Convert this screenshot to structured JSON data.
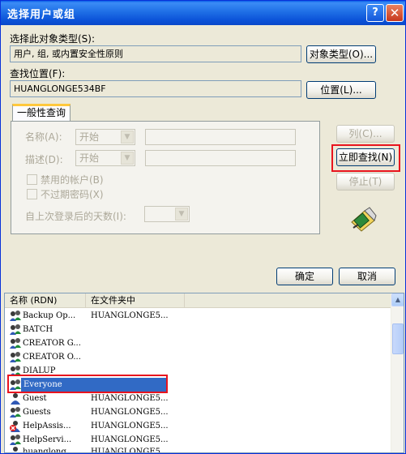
{
  "window": {
    "title": "选择用户或组",
    "help_glyph": "?",
    "close_glyph": "✕"
  },
  "object_type": {
    "label": "选择此对象类型(S):",
    "value": "用户, 组, 或内置安全性原则",
    "button": "对象类型(O)..."
  },
  "location": {
    "label": "查找位置(F):",
    "value": "HUANGLONGE534BF",
    "button": "位置(L)..."
  },
  "tab": {
    "label": "一般性查询"
  },
  "query": {
    "name_label": "名称(A):",
    "name_combo": "开始",
    "desc_label": "描述(D):",
    "desc_combo": "开始",
    "disabled_accounts": "禁用的帐户(B)",
    "non_expiring_pwd": "不过期密码(X)",
    "days_label": "自上次登录后的天数(I):"
  },
  "side_buttons": {
    "columns": "列(C)...",
    "find_now": "立即查找(N)",
    "stop": "停止(T)"
  },
  "dialog_buttons": {
    "ok": "确定",
    "cancel": "取消"
  },
  "results": {
    "columns": [
      "名称 (RDN)",
      "在文件夹中"
    ],
    "rows": [
      {
        "name": "Backup Op...",
        "folder": "HUANGLONGE5..."
      },
      {
        "name": "BATCH",
        "folder": ""
      },
      {
        "name": "CREATOR G...",
        "folder": ""
      },
      {
        "name": "CREATOR O...",
        "folder": ""
      },
      {
        "name": "DIALUP",
        "folder": ""
      },
      {
        "name": "Everyone",
        "folder": ""
      },
      {
        "name": "Guest",
        "folder": "HUANGLONGE5..."
      },
      {
        "name": "Guests",
        "folder": "HUANGLONGE5..."
      },
      {
        "name": "HelpAssis...",
        "folder": "HUANGLONGE5..."
      },
      {
        "name": "HelpServi...",
        "folder": "HUANGLONGE5..."
      },
      {
        "name": "huanglong",
        "folder": "HUANGLONGE5..."
      }
    ],
    "selected": "Everyone"
  },
  "colors": {
    "highlight_box": "#e8141e",
    "selection": "#316ac5",
    "title_bar": "#0a5fe8"
  },
  "icons": [
    "group-icon",
    "user-icon",
    "disabled-user-icon",
    "search-flashlight-icon"
  ]
}
